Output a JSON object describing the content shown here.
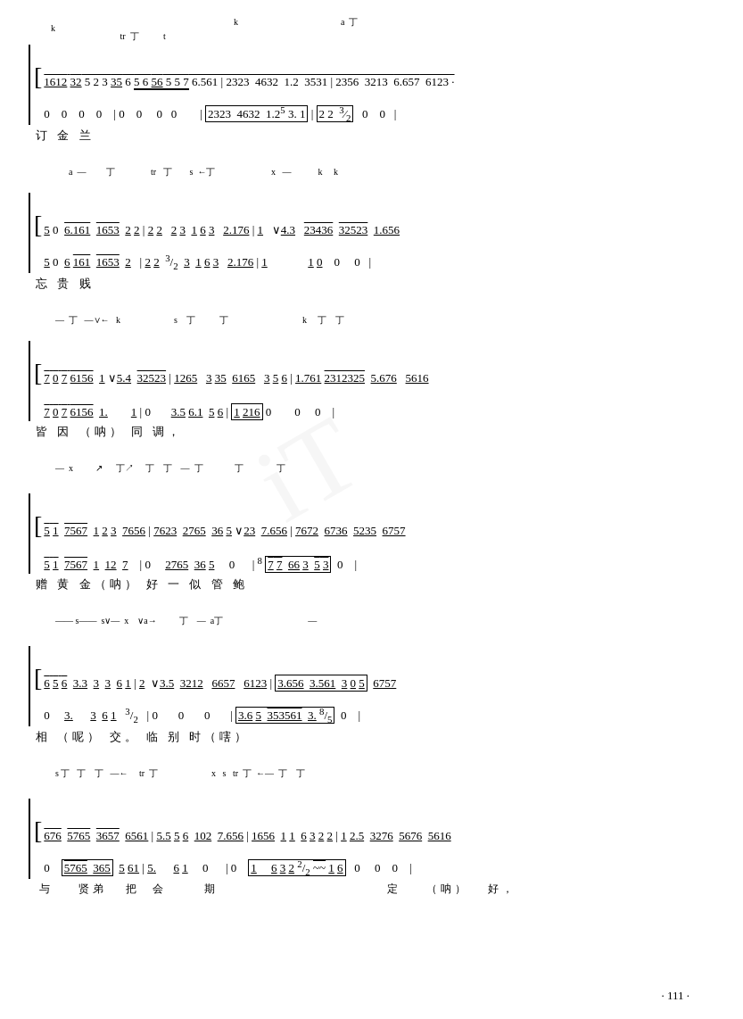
{
  "page": {
    "title": "Music Score Page 111",
    "page_number": "· 111 ·",
    "watermark": "iT"
  },
  "sections": [
    {
      "id": "section1",
      "top_notation": "k                    tr  丁          t                              丁   k                          a  丁",
      "top_notes": "1612 32 5 2 3 35 6 5 6 56 5 5 7 6.561  2323  4632  1.2  3531  2356  3213  6.657  6123",
      "bottom_notes": "0    0   0   0    0   0   0   0       2323  4632  1.2⁵ 3.1   2 2  ³/2    0      0",
      "lyrics": "订    金    兰"
    },
    {
      "id": "section2",
      "top_notation": "     a  —     丁           tr    丁    s  ←丁              x  —          k     k",
      "top_notes": "5 0  6.161  1653  2 2   2 2   2 3  1 6 3   2.176   1   ∨4.3   23436   32523   1.656",
      "bottom_notes": "5 0  6 161  1653  2    2 2  ³/2 3  1 6 3   2.176   1         1 0     0       0",
      "lyrics": "忘    贵      贱"
    },
    {
      "id": "section3",
      "top_notation": "—  丁   —∨←   k                    s    丁          丁                       k     丁    丁",
      "top_notes": "7 0 7  6156  1 ∨5.4  32523   1265   3 35  6165   3 5 6   1.761  2312325  5.676   5616",
      "bottom_notes": "7 0 7  6156  1.       1     0      3.5 6.1  5 6    1 216  0         0       0",
      "lyrics": "皆      因    （呐）          同           调，"
    },
    {
      "id": "section4",
      "top_notation": "—  x          ↗     丁↗     丁    丁    —  丁              丁             丁",
      "top_notes": "5 1  7567  1 2 3  7656   7623  2765  36 5 ∨23  7.656   7672  6736   5235  6757",
      "bottom_notes": "5 1  7567  1  12  7      0     2765  36 5    0      ⁸/ 7 7  66 3   5 3   0",
      "lyrics": "赠    黄    金（呐）            好    一  似              管      鲍"
    },
    {
      "id": "section5",
      "top_notation": "—— s——  s∨—  x   ∨a→          丁    —  a丁                              —",
      "top_notes": "6 5 6  3.3  3  3  6 1   2  ∨3.5  3212   6657   6123   3.656   3.561  3 0 5   6757",
      "bottom_notes": "0      3.     3  6 1   ³/2   0      0       0     3.6 5   353561  3. ⁸/5  0",
      "lyrics": "相    （呢）       交。                     临    别      时（嗐）"
    },
    {
      "id": "section6",
      "top_notation": "s 丁   丁    丁   —←    tr  丁                     x   s   tr  丁  ←—  丁    丁",
      "top_notes": "676  5765  3657  6561   5.5 5 6  102  7.656   1656  1 1  6 3 2 2   1 2.5  3276  5676  5616",
      "bottom_notes": "0    5765  365   5 61   5.      6 1   0      0   1     6 3 2 ²/  1 6    0      0     0",
      "lyrics_top": "与    贤弟   把  会      期                    定    （呐）  好，",
      "lyrics": "与    贤弟   把  会      期                    定    （呐）  好，"
    }
  ]
}
